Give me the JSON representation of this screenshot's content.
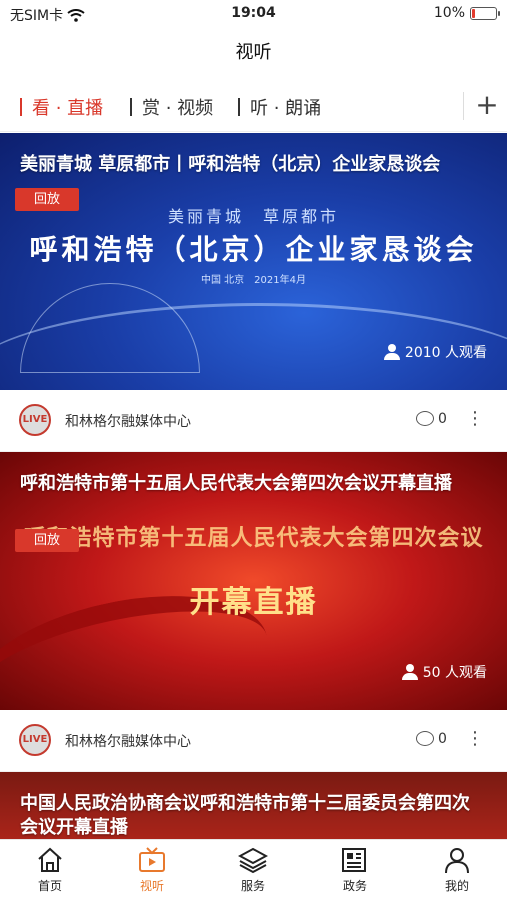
{
  "status": {
    "carrier": "无SIM卡",
    "time": "19:04",
    "battery": "10%"
  },
  "nav": {
    "title": "视听"
  },
  "tabs": [
    {
      "label": "看 · 直播",
      "active": true
    },
    {
      "label": "赏 · 视频",
      "active": false
    },
    {
      "label": "听 · 朗诵",
      "active": false
    }
  ],
  "cards": [
    {
      "title": "美丽青城 草原都市丨呼和浩特（北京）企业家恳谈会",
      "badge": "回放",
      "viewers": "2010 人观看",
      "banner_line1": "美丽青城　草原都市",
      "banner_line2": "呼和浩特（北京）企业家恳谈会",
      "banner_line3": "中国  北京　2021年4月",
      "source": "和林格尔融媒体中心",
      "comments": "0"
    },
    {
      "title": "呼和浩特市第十五届人民代表大会第四次会议开幕直播",
      "badge": "回放",
      "viewers": "50 人观看",
      "banner_line1": "呼和浩特市第十五届人民代表大会第四次会议",
      "banner_line2": "开幕直播",
      "source": "和林格尔融媒体中心",
      "comments": "0"
    },
    {
      "title": "中国人民政治协商会议呼和浩特市第十三届委员会第四次会议开幕直播"
    }
  ],
  "live_logo": "LIVE",
  "tabbar": [
    {
      "label": "首页",
      "icon": "home-icon",
      "active": false
    },
    {
      "label": "视听",
      "icon": "tv-icon",
      "active": true
    },
    {
      "label": "服务",
      "icon": "layers-icon",
      "active": false
    },
    {
      "label": "政务",
      "icon": "newspaper-icon",
      "active": false
    },
    {
      "label": "我的",
      "icon": "user-icon",
      "active": false
    }
  ],
  "colors": {
    "accent": "#d9382b",
    "tabbar_active": "#e8792d"
  }
}
